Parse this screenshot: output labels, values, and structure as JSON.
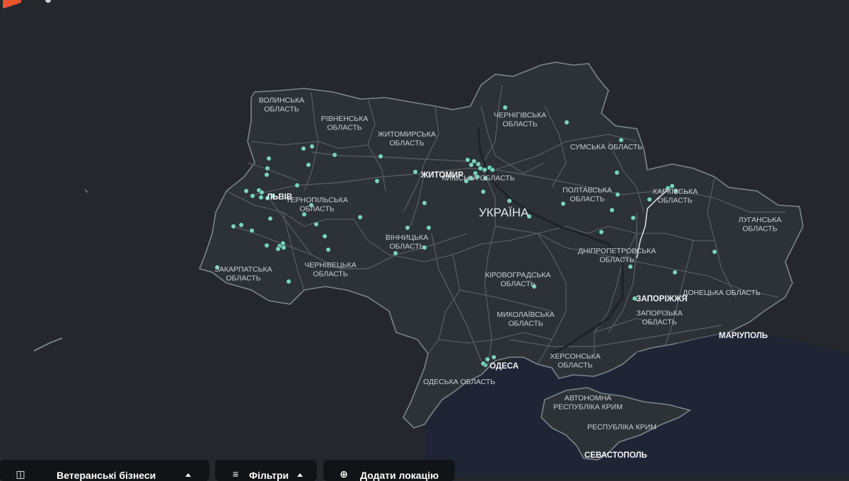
{
  "map": {
    "country_label": "УКРАЇНА",
    "region_labels": [
      {
        "id": "volyn",
        "lines": [
          "ВОЛИНСЬКА",
          "ОБЛАСТЬ"
        ]
      },
      {
        "id": "rivne",
        "lines": [
          "РІВНЕНСЬКА",
          "ОБЛАСТЬ"
        ]
      },
      {
        "id": "zhytomyr",
        "lines": [
          "ЖИТОМИРСЬКА",
          "ОБЛАСТЬ"
        ]
      },
      {
        "id": "chernihiv",
        "lines": [
          "ЧЕРНІГІВСЬКА",
          "ОБЛАСТЬ"
        ]
      },
      {
        "id": "sumy",
        "lines": [
          "СУМСЬКА ОБЛАСТЬ"
        ]
      },
      {
        "id": "kyiv",
        "lines": [
          "КИЇВСЬКА ОБЛАСТЬ"
        ]
      },
      {
        "id": "ternopil",
        "lines": [
          "ТЕРНОПІЛЬСЬКА",
          "ОБЛАСТЬ"
        ]
      },
      {
        "id": "poltava",
        "lines": [
          "ПОЛТАВСЬКА",
          "ОБЛАСТЬ"
        ]
      },
      {
        "id": "kharkiv",
        "lines": [
          "ХАРКІВСЬКА",
          "ОБЛАСТЬ"
        ]
      },
      {
        "id": "luhansk",
        "lines": [
          "ЛУГАНСЬКА",
          "ОБЛАСТЬ"
        ]
      },
      {
        "id": "vinnytsia",
        "lines": [
          "ВІННИЦЬКА",
          "ОБЛАСТЬ"
        ]
      },
      {
        "id": "zakarpattia",
        "lines": [
          "ЗАКАРПАТСЬКА",
          "ОБЛАСТЬ"
        ]
      },
      {
        "id": "chernivtsi",
        "lines": [
          "ЧЕРНІВЕЦЬКА",
          "ОБЛАСТЬ"
        ]
      },
      {
        "id": "dnipro",
        "lines": [
          "ДНІПРОПЕТРОВСЬКА",
          "ОБЛАСТЬ"
        ]
      },
      {
        "id": "kirovohrad",
        "lines": [
          "КІРОВОГРАДСЬКА",
          "ОБЛАСТЬ"
        ]
      },
      {
        "id": "donetsk",
        "lines": [
          "ДОНЕЦЬКА ОБЛАСТЬ"
        ]
      },
      {
        "id": "zaporizhzhia",
        "lines": [
          "ЗАПОРІЗЬКА",
          "ОБЛАСТЬ"
        ]
      },
      {
        "id": "mykolaiv",
        "lines": [
          "МИКОЛАЇВСЬКА",
          "ОБЛАСТЬ"
        ]
      },
      {
        "id": "kherson",
        "lines": [
          "ХЕРСОНСЬКА",
          "ОБЛАСТЬ"
        ]
      },
      {
        "id": "odesa_obl",
        "lines": [
          "ОДЕСЬКА ОБЛАСТЬ"
        ]
      },
      {
        "id": "crimea_ar",
        "lines": [
          "АВТОНОМНА",
          "РЕСПУБЛІКА КРИМ"
        ]
      },
      {
        "id": "crimea_rep",
        "lines": [
          "РЕСПУБЛІКА КРИМ"
        ]
      }
    ],
    "city_labels": [
      {
        "id": "lviv",
        "text": "ЛЬВІВ"
      },
      {
        "id": "zhytomyr",
        "text": "ЖИТОМИР"
      },
      {
        "id": "odesa",
        "text": "ОДЕСА"
      },
      {
        "id": "zaporizhzhia",
        "text": "ЗАПОРІЖЖЯ"
      },
      {
        "id": "mariupol",
        "text": "МАРІУПОЛЬ"
      },
      {
        "id": "sevastopol",
        "text": "СЕВАСТОПОЛЬ"
      }
    ],
    "colors": {
      "land": "#2c3236",
      "sea": "#1f2535",
      "border": "#7c858c",
      "roads": "#5b6368",
      "marker": "#7ad3bf",
      "route": "#e9eef0"
    }
  },
  "toolbar": {
    "layers_button": {
      "label": "Ветеранські бізнеси",
      "icon": "map-icon"
    },
    "filters_button": {
      "label": "Фільтри",
      "icon": "sliders-icon"
    },
    "add_location_button": {
      "label": "Додати локацію",
      "icon": "plus-circle-icon"
    }
  }
}
